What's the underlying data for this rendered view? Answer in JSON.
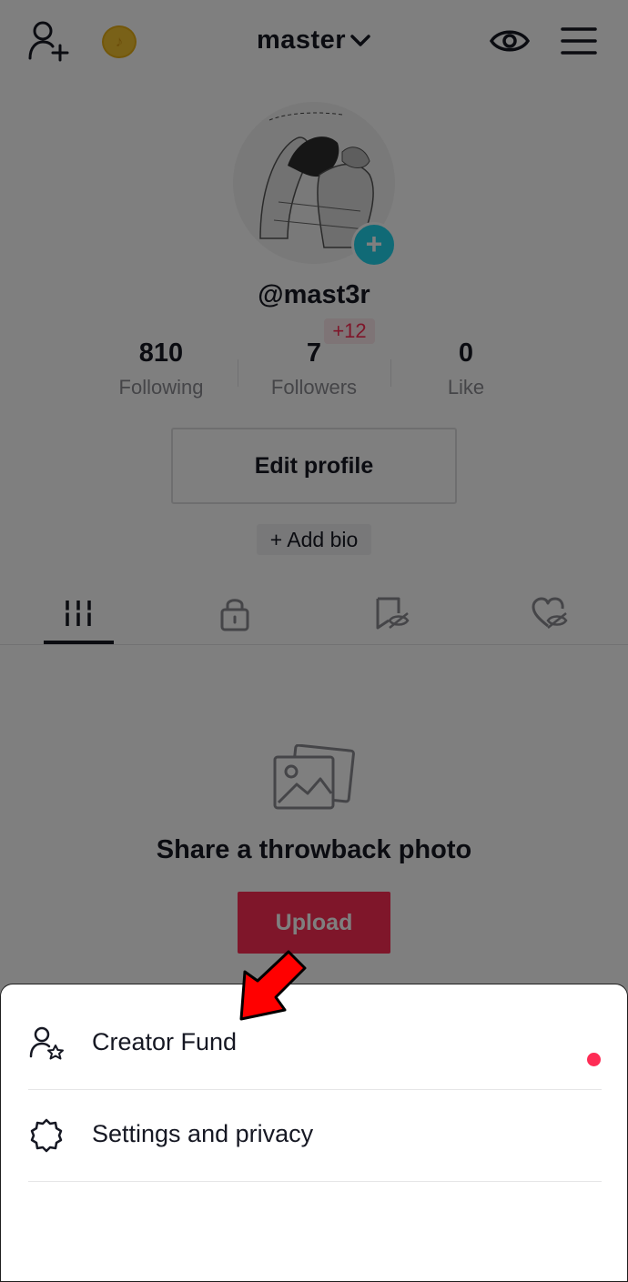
{
  "header": {
    "account_name": "master",
    "coin_glyph": "♪"
  },
  "profile": {
    "username": "@mast3r",
    "avatar_add_symbol": "+",
    "followers_badge": "+12",
    "stats": [
      {
        "value": "810",
        "label": "Following"
      },
      {
        "value": "7",
        "label": "Followers"
      },
      {
        "value": "0",
        "label": "Like"
      }
    ],
    "edit_profile_label": "Edit profile",
    "add_bio_label": "+ Add bio"
  },
  "tabs": [
    {
      "icon": "grid-icon",
      "active": true
    },
    {
      "icon": "lock-icon",
      "active": false
    },
    {
      "icon": "hidden-bookmark-icon",
      "active": false
    },
    {
      "icon": "hidden-heart-icon",
      "active": false
    }
  ],
  "empty_state": {
    "icon": "photo-icon",
    "title": "Share a throwback photo",
    "upload_label": "Upload"
  },
  "sheet": {
    "items": [
      {
        "icon": "person-star-icon",
        "label": "Creator Fund",
        "has_dot": true
      },
      {
        "icon": "gear-icon",
        "label": "Settings and privacy",
        "has_dot": false
      }
    ]
  },
  "colors": {
    "accent": "#fe2c55",
    "avatar_add": "#20d5ec",
    "coin": "#f2c230",
    "annotation_arrow": "#ff0000"
  }
}
